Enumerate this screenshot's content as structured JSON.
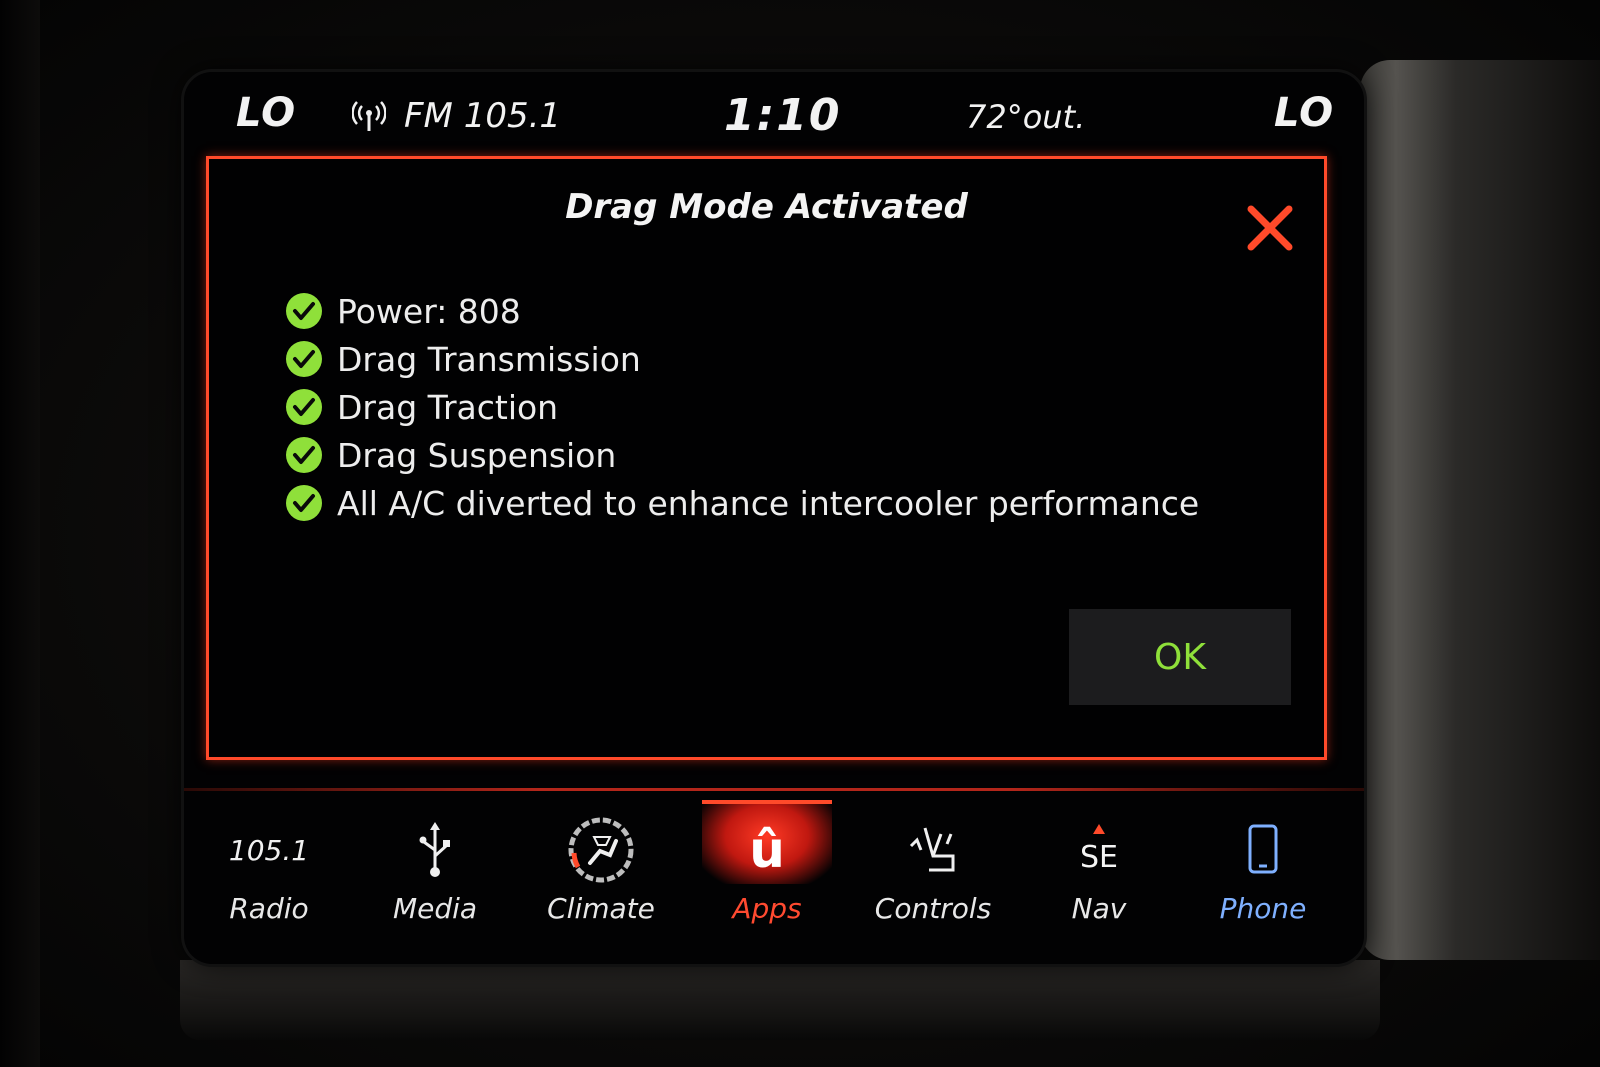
{
  "status_bar": {
    "temp_left": "LO",
    "radio_band": "FM 105.1",
    "clock": "1:10",
    "outside_temp": "72°out.",
    "temp_right": "LO"
  },
  "dialog": {
    "title": "Drag Mode Activated",
    "items": [
      {
        "label": "Power: 808"
      },
      {
        "label": "Drag Transmission"
      },
      {
        "label": "Drag Traction"
      },
      {
        "label": "Drag Suspension"
      },
      {
        "label": "All A/C diverted to enhance intercooler performance"
      }
    ],
    "ok_label": "OK"
  },
  "nav": {
    "radio": {
      "freq": "105.1",
      "label": "Radio"
    },
    "media": {
      "label": "Media"
    },
    "climate": {
      "label": "Climate"
    },
    "apps": {
      "label": "Apps",
      "icon_text": "û"
    },
    "controls": {
      "label": "Controls"
    },
    "nav": {
      "label": "Nav",
      "heading": "SE"
    },
    "phone": {
      "label": "Phone"
    }
  },
  "colors": {
    "accent_red": "#ff4a2a",
    "check_green": "#8fe03a",
    "ok_text": "#8fe03a",
    "phone_label": "#7fb0ff"
  },
  "icons": {
    "radio": "radio-signal-icon",
    "close": "close-x-icon",
    "check": "check-circle-icon",
    "media": "usb-icon",
    "climate": "climate-seat-icon",
    "apps": "uconnect-apps-icon",
    "controls": "seat-controls-icon",
    "nav": "compass-icon",
    "phone": "phone-icon"
  }
}
